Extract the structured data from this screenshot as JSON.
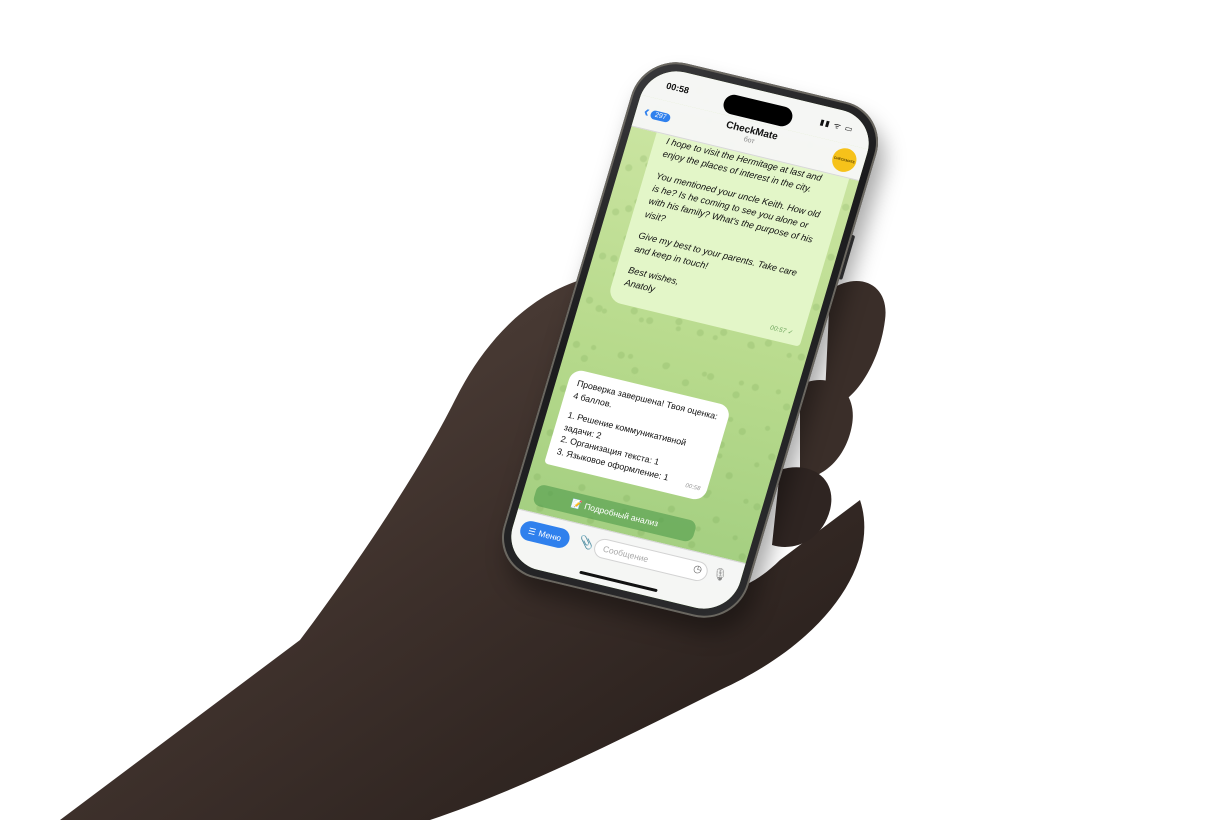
{
  "status_bar": {
    "time": "00:58",
    "system_icons": "▮▮ ᯤ ▭"
  },
  "header": {
    "back_count": "297",
    "title": "CheckMate",
    "subtitle": "бот",
    "avatar_text": "CHECKMATE"
  },
  "messages": {
    "outgoing": {
      "paragraphs": [
        "best time for me to go fishing and camping. I'm travelling to St Petersburg this summer. I hope to visit the Hermitage at last and enjoy the places of interest in the city.",
        "You mentioned your uncle Keith. How old is he? Is he coming to see you alone or with his family? What's the purpose of his visit?",
        "Give my best to your parents. Take care and keep in touch!",
        "Best wishes,\nAnatoly"
      ],
      "time": "00:57 ✓"
    },
    "incoming": {
      "paragraphs": [
        "Проверка завершена! Твоя оценка: 4 баллов.",
        "1. Решение коммуникативной задачи: 2\n2. Организация текста: 1\n3. Языковое оформление: 1"
      ],
      "time": "00:58"
    },
    "inline_button": {
      "icon": "📝",
      "label": "Подробный анализ"
    }
  },
  "input_bar": {
    "menu_label": "Меню",
    "placeholder": "Сообщение"
  },
  "colors": {
    "accent": "#2f80ed",
    "chat_bg": "#b7da8c",
    "outgoing_bubble": "#e3f6c8",
    "avatar": "#f6c21a"
  },
  "icons": [
    "back-chevron-icon",
    "paperclip-icon",
    "sticker-icon",
    "microphone-icon",
    "menu-icon"
  ]
}
